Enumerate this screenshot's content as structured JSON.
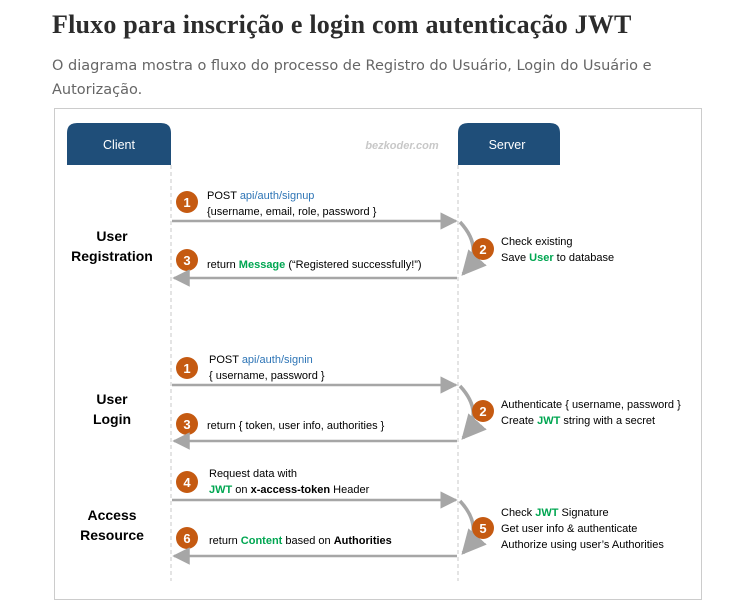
{
  "page": {
    "heading": "Fluxo para inscrição e login com autenticação JWT",
    "description": "O diagrama mostra o fluxo do processo de Registro do Usuário, Login do Usuário e Autorização."
  },
  "diagram": {
    "client_label": "Client",
    "server_label": "Server",
    "watermark": "bezkoder.com",
    "colors": {
      "header": "#1f4e79",
      "step": "#c55a11",
      "link": "#2e75b6",
      "highlight": "#00a651",
      "arrow": "#a6a6a6"
    },
    "sections": {
      "registration": [
        "User",
        "Registration"
      ],
      "login": [
        "User",
        "Login"
      ],
      "access": [
        "Access",
        "Resource"
      ]
    },
    "steps": {
      "reg1": {
        "num": "1",
        "method": "POST ",
        "endpoint": "api/auth/signup",
        "body": "{username, email, role, password }"
      },
      "reg2": {
        "num": "2",
        "line1": "Check existing",
        "save_pre": "Save ",
        "save_hl": "User",
        "save_post": " to database"
      },
      "reg3": {
        "num": "3",
        "pre": "return ",
        "hl": "Message",
        "post": " (“Registered successfully!”)"
      },
      "login1": {
        "num": "1",
        "method": "POST ",
        "endpoint": "api/auth/signin",
        "body": "{ username, password }"
      },
      "login2": {
        "num": "2",
        "line1": "Authenticate { username, password }",
        "create_pre": "Create ",
        "create_hl": "JWT",
        "create_post": " string with a secret"
      },
      "login3": {
        "num": "3",
        "text": "return { token, user info, authorities }"
      },
      "acc4": {
        "num": "4",
        "line1": "Request  data with",
        "jwt": "JWT",
        "on": " on ",
        "header": "x-access-token",
        "post": " Header"
      },
      "acc5": {
        "num": "5",
        "check_pre": "Check ",
        "check_hl": "JWT",
        "check_post": " Signature",
        "line2": "Get user info & authenticate",
        "line3": "Authorize using user’s Authorities"
      },
      "acc6": {
        "num": "6",
        "pre": "return ",
        "content": "Content",
        "mid": " based on ",
        "auth": "Authorities"
      }
    }
  }
}
